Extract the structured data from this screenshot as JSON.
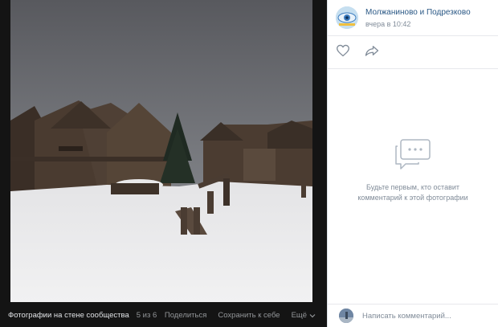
{
  "photo_viewer": {
    "album_label": "Фотографии на стене сообщества",
    "counter": "5 из 6",
    "share_label": "Поделиться",
    "save_label": "Сохранить к себе",
    "more_label": "Ещё"
  },
  "post": {
    "community_name": "Молжаниново и Подрезково",
    "timestamp": "вчера в 10:42"
  },
  "comments": {
    "empty_text_line1": "Будьте первым, кто оставит",
    "empty_text_line2": "комментарий к этой фотографии",
    "input_placeholder": "Написать комментарий..."
  },
  "icons": {
    "like": "heart-icon",
    "share": "share-arrow-icon",
    "empty": "comments-bubble-icon",
    "more": "chevron-down-icon"
  },
  "colors": {
    "link": "#2a5885",
    "muted": "#818c99",
    "viewer_bg": "#141414"
  }
}
